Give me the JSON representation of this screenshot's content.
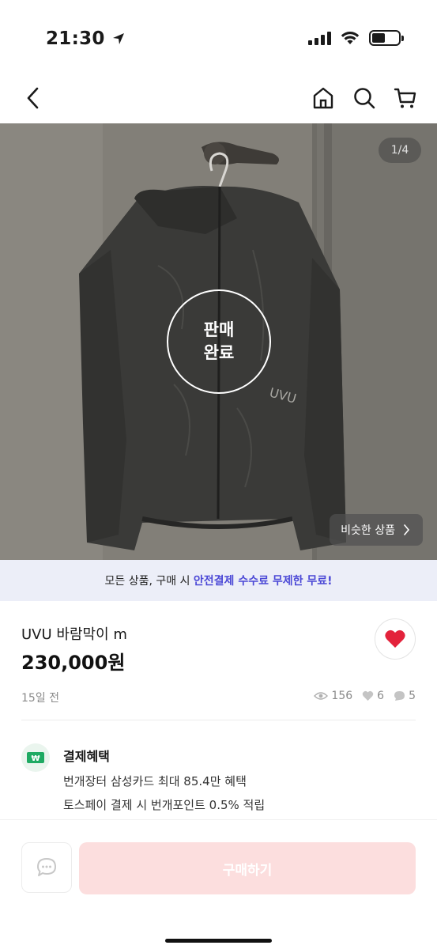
{
  "status_bar": {
    "time": "21:30"
  },
  "nav": {
    "icons": [
      "back-arrow-icon",
      "home-icon",
      "search-icon",
      "cart-icon"
    ]
  },
  "hero": {
    "page_indicator": "1/4",
    "sold_badge": [
      "판매",
      "완료"
    ],
    "similar_button": "비슷한 상품"
  },
  "banner": {
    "prefix": "모든 상품, 구매 시 ",
    "highlight": "안전결제 수수료 무제한 무료!"
  },
  "product": {
    "title": "UVU 바람막이 m",
    "price": "230,000원",
    "posted": "15일 전",
    "views": "156",
    "likes": "6",
    "chats": "5"
  },
  "benefits": {
    "title": "결제혜택",
    "lines": [
      "번개장터 삼성카드 최대 85.4만 혜택",
      "토스페이 결제 시 번개포인트 0.5% 적립"
    ]
  },
  "bottom": {
    "buy_label": "구매하기"
  },
  "colors": {
    "accent": "#4b48d6",
    "heart": "#e3223b",
    "buy_disabled": "#fcdede"
  }
}
